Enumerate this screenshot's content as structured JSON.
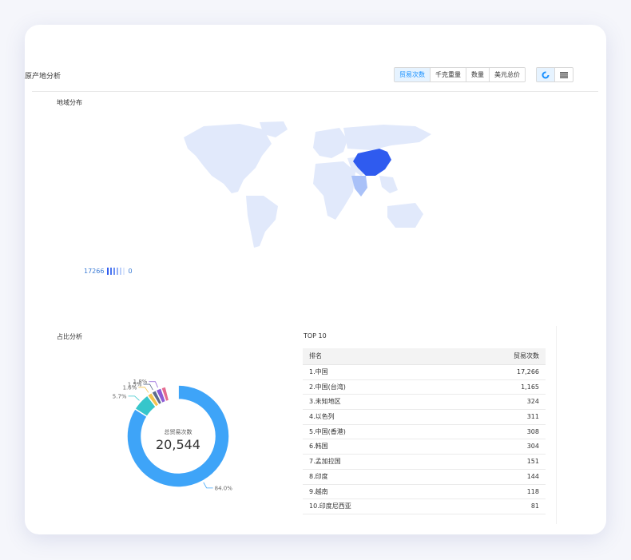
{
  "header": {
    "title": "原产地分析",
    "tabs": [
      {
        "label": "贸易次数",
        "active": true
      },
      {
        "label": "千克重量",
        "active": false
      },
      {
        "label": "数量",
        "active": false
      },
      {
        "label": "美元总价",
        "active": false
      }
    ],
    "views": [
      {
        "icon": "donut-chart-icon",
        "active": true
      },
      {
        "icon": "table-grid-icon",
        "active": false
      }
    ]
  },
  "map_section": {
    "title": "地域分布",
    "legend_max": "17266",
    "legend_min": "0",
    "colors": {
      "high": "#2f5bef",
      "mid": "#a9c1f8",
      "low": "#e1e9fb"
    }
  },
  "share_section": {
    "title": "占比分析",
    "center_label": "总贸易次数",
    "center_value": "20,544"
  },
  "chart_data": {
    "type": "pie",
    "total_label": "总贸易次数",
    "total": "20,544",
    "slices": [
      {
        "value": 84.0,
        "label": "84.0%",
        "color": "#3ea4f8"
      },
      {
        "value": 5.7,
        "label": "5.7%",
        "color": "#36c6cb"
      },
      {
        "value": 1.6,
        "label": "1.6%",
        "color": "#f4c44e"
      },
      {
        "value": 1.5,
        "label": "1.5%",
        "color": "#5c6c8c"
      },
      {
        "value": 1.8,
        "label": "1.8%",
        "color": "#8d5bd6"
      },
      {
        "value": 1.5,
        "label": "",
        "color": "#e56b8f"
      },
      {
        "value": 3.9,
        "label": "",
        "color": "#ffffff"
      }
    ]
  },
  "top10": {
    "title": "TOP 10",
    "col_rank": "排名",
    "col_count": "贸易次数",
    "rows": [
      {
        "name": "1.中国",
        "count": "17,266"
      },
      {
        "name": "2.中国(台湾)",
        "count": "1,165"
      },
      {
        "name": "3.未知地区",
        "count": "324"
      },
      {
        "name": "4.以色列",
        "count": "311"
      },
      {
        "name": "5.中国(香港)",
        "count": "308"
      },
      {
        "name": "6.韩国",
        "count": "304"
      },
      {
        "name": "7.孟加拉国",
        "count": "151"
      },
      {
        "name": "8.印度",
        "count": "144"
      },
      {
        "name": "9.越南",
        "count": "118"
      },
      {
        "name": "10.印度尼西亚",
        "count": "81"
      }
    ]
  }
}
